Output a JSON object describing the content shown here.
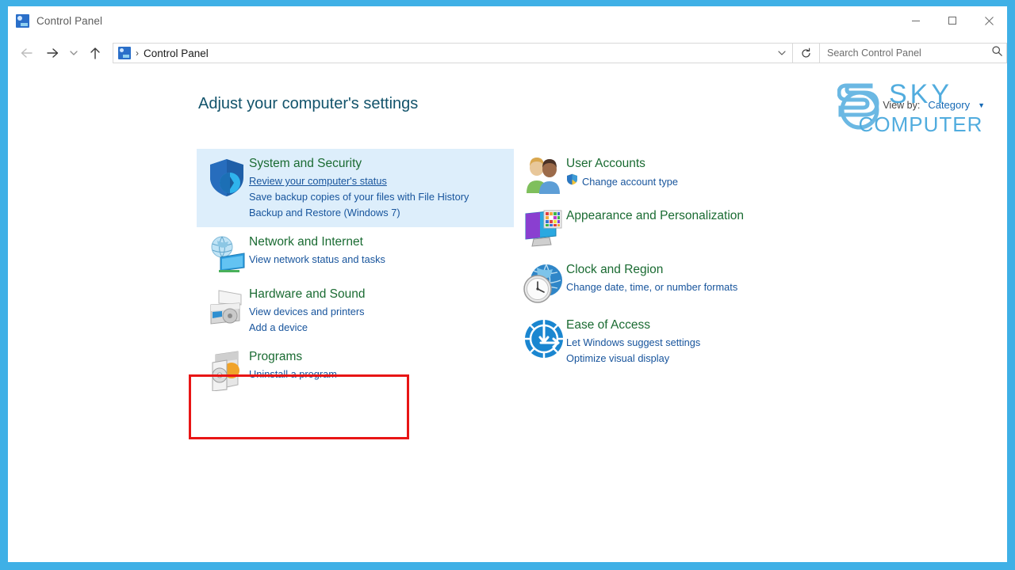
{
  "window": {
    "title": "Control Panel",
    "title_icon": "control-panel-icon",
    "controls": {
      "minimize": "Minimize",
      "maximize": "Maximize",
      "close": "Close"
    }
  },
  "nav": {
    "back": "Back",
    "forward": "Forward",
    "recent": "Recent locations",
    "up": "Up",
    "refresh": "Refresh",
    "dropdown": "Previous locations"
  },
  "address": {
    "crumb_icon": "control-panel-icon",
    "separator": "›",
    "crumb": "Control Panel"
  },
  "search": {
    "placeholder": "Search Control Panel",
    "icon": "search-icon"
  },
  "main": {
    "page_title": "Adjust your computer's settings",
    "view_by": {
      "label": "View by:",
      "value": "Category",
      "caret": "▼"
    }
  },
  "categories": {
    "left": [
      {
        "id": "system-and-security",
        "icon": "shield-security-icon",
        "title": "System and Security",
        "highlighted": true,
        "links": [
          {
            "text": "Review your computer's status",
            "underline": true,
            "shield": false
          },
          {
            "text": "Save backup copies of your files with File History",
            "underline": false,
            "shield": false
          },
          {
            "text": "Backup and Restore (Windows 7)",
            "underline": false,
            "shield": false
          }
        ]
      },
      {
        "id": "network-and-internet",
        "icon": "network-globe-icon",
        "title": "Network and Internet",
        "highlighted": false,
        "links": [
          {
            "text": "View network status and tasks",
            "underline": false,
            "shield": false
          }
        ]
      },
      {
        "id": "hardware-and-sound",
        "icon": "printer-icon",
        "title": "Hardware and Sound",
        "highlighted": false,
        "links": [
          {
            "text": "View devices and printers",
            "underline": false,
            "shield": false
          },
          {
            "text": "Add a device",
            "underline": false,
            "shield": false
          }
        ]
      },
      {
        "id": "programs",
        "icon": "programs-disc-icon",
        "title": "Programs",
        "highlighted": false,
        "links": [
          {
            "text": "Uninstall a program",
            "underline": false,
            "shield": false
          }
        ]
      }
    ],
    "right": [
      {
        "id": "user-accounts",
        "icon": "users-icon",
        "title": "User Accounts",
        "highlighted": false,
        "links": [
          {
            "text": "Change account type",
            "underline": false,
            "shield": true
          }
        ]
      },
      {
        "id": "appearance-and-personalization",
        "icon": "monitor-palette-icon",
        "title": "Appearance and Personalization",
        "highlighted": false,
        "links": []
      },
      {
        "id": "clock-and-region",
        "icon": "clock-globe-icon",
        "title": "Clock and Region",
        "highlighted": false,
        "links": [
          {
            "text": "Change date, time, or number formats",
            "underline": false,
            "shield": false
          }
        ]
      },
      {
        "id": "ease-of-access",
        "icon": "ease-of-access-icon",
        "title": "Ease of Access",
        "highlighted": false,
        "links": [
          {
            "text": "Let Windows suggest settings",
            "underline": false,
            "shield": false
          },
          {
            "text": "Optimize visual display",
            "underline": false,
            "shield": false
          }
        ]
      }
    ]
  },
  "annotation": {
    "type": "red-highlight-box",
    "target": "hardware-and-sound",
    "color": "#e81515"
  },
  "watermark": {
    "line1": "SKY",
    "line2": "COMPUTER",
    "color": "#2196d6"
  },
  "colors": {
    "frame": "#3fb0e6",
    "category_title": "#1a6b32",
    "link": "#17549c",
    "page_title": "#12536b",
    "highlight_bg": "#ddeefb"
  }
}
